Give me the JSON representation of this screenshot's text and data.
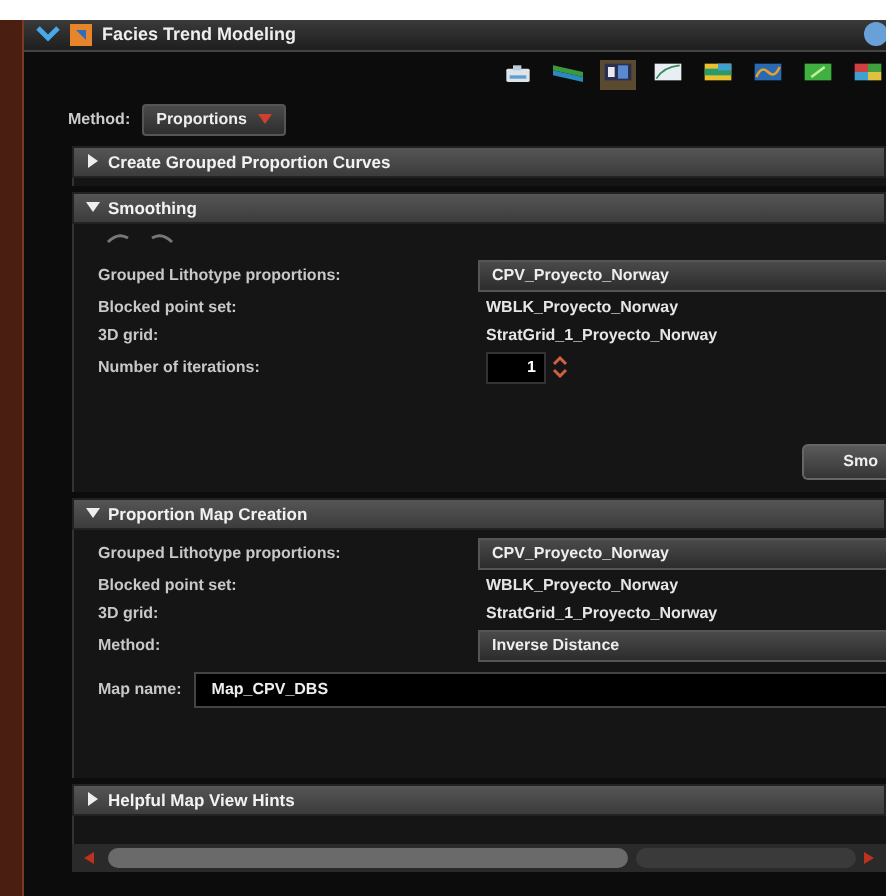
{
  "panel": {
    "title": "Facies Trend Modeling",
    "expanded": true
  },
  "toolbar": [
    {
      "selected": false
    },
    {
      "selected": false
    },
    {
      "selected": true
    },
    {
      "selected": false
    },
    {
      "selected": false
    },
    {
      "selected": false
    },
    {
      "selected": false
    },
    {
      "selected": false
    }
  ],
  "method": {
    "label": "Method:",
    "value": "Proportions"
  },
  "sections": [
    {
      "title": "Create Grouped Proportion Curves",
      "expanded": false
    },
    {
      "title": "Smoothing",
      "expanded": true,
      "undo_redo": true,
      "fields": [
        {
          "kind": "dropdown",
          "label": "Grouped Lithotype proportions:",
          "value": "CPV_Proyecto_Norway"
        },
        {
          "kind": "text",
          "label": "Blocked point set:",
          "value": "WBLK_Proyecto_Norway"
        },
        {
          "kind": "text",
          "label": "3D grid:",
          "value": "StratGrid_1_Proyecto_Norway"
        },
        {
          "kind": "spin",
          "label": "Number of iterations:",
          "value": "1"
        }
      ],
      "button": "Smo"
    },
    {
      "title": "Proportion Map Creation",
      "expanded": true,
      "fields": [
        {
          "kind": "dropdown",
          "label": "Grouped Lithotype proportions:",
          "value": "CPV_Proyecto_Norway"
        },
        {
          "kind": "text",
          "label": "Blocked point set:",
          "value": "WBLK_Proyecto_Norway"
        },
        {
          "kind": "text",
          "label": "3D grid:",
          "value": "StratGrid_1_Proyecto_Norway"
        },
        {
          "kind": "dropdown",
          "label": "Method:",
          "value": "Inverse Distance"
        },
        {
          "kind": "input",
          "label": "Map name:",
          "value": "Map_CPV_DBS"
        }
      ]
    },
    {
      "title": "Helpful Map View Hints",
      "expanded": false
    }
  ]
}
